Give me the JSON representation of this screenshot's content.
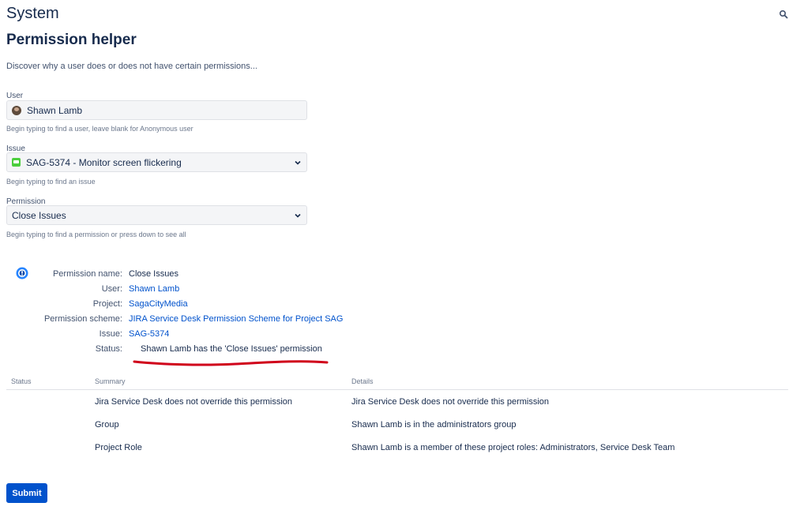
{
  "header": {
    "system_title": "System"
  },
  "page": {
    "title": "Permission helper",
    "description": "Discover why a user does or does not have certain permissions..."
  },
  "form": {
    "user": {
      "label": "User",
      "value": "Shawn Lamb",
      "hint": "Begin typing to find a user, leave blank for Anonymous user"
    },
    "issue": {
      "label": "Issue",
      "value": "SAG-5374 - Monitor screen flickering",
      "hint": "Begin typing to find an issue"
    },
    "permission": {
      "label": "Permission",
      "value": "Close Issues",
      "hint": "Begin typing to find a permission or press down to see all"
    }
  },
  "result": {
    "permission_name": {
      "label": "Permission name:",
      "value": "Close Issues"
    },
    "user": {
      "label": "User:",
      "value": "Shawn Lamb"
    },
    "project": {
      "label": "Project:",
      "value": "SagaCityMedia"
    },
    "scheme": {
      "label": "Permission scheme:",
      "value": "JIRA Service Desk Permission Scheme for Project SAG"
    },
    "issue": {
      "label": "Issue:",
      "value": "SAG-5374"
    },
    "status": {
      "label": "Status:",
      "value": "Shawn Lamb has the 'Close Issues' permission"
    }
  },
  "table": {
    "headers": [
      "Status",
      "Summary",
      "Details"
    ],
    "rows": [
      {
        "status": "",
        "summary": "Jira Service Desk does not override this permission",
        "details": "Jira Service Desk does not override this permission"
      },
      {
        "status": "",
        "summary": "Group",
        "details": "Shawn Lamb is in the administrators group"
      },
      {
        "status": "",
        "summary": "Project Role",
        "details": "Shawn Lamb is a member of these project roles: Administrators, Service Desk Team"
      }
    ]
  },
  "actions": {
    "submit_label": "Submit"
  },
  "colors": {
    "link": "#0052cc",
    "button": "#0052cc",
    "annotation_underline": "#d0021b",
    "issue_icon": "#4bce3c"
  }
}
